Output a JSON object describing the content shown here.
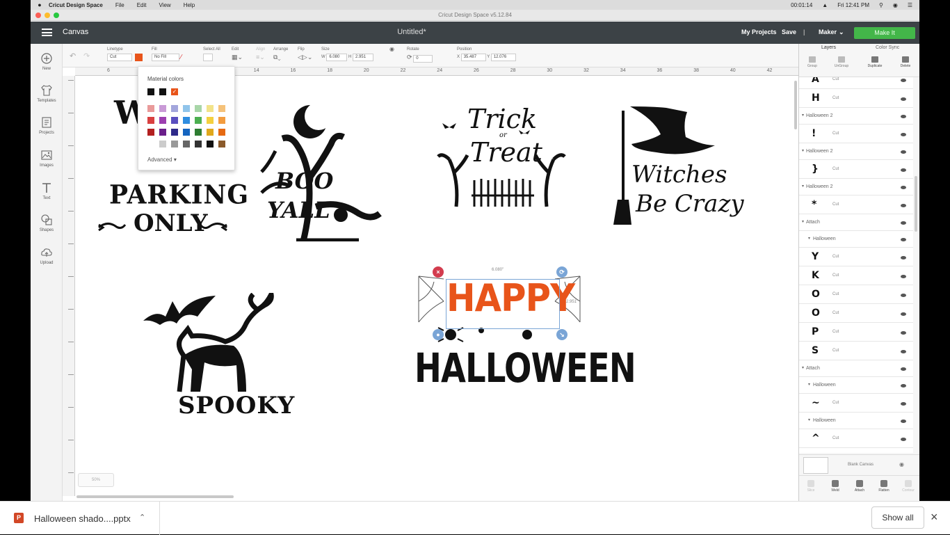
{
  "mac_menu": {
    "app_name": "Cricut Design Space",
    "items": [
      "File",
      "Edit",
      "View",
      "Help"
    ],
    "recording_time": "00:01:14",
    "clock": "Fri 12:41 PM"
  },
  "window": {
    "title": "Cricut Design Space v5.12.84"
  },
  "header": {
    "canvas_label": "Canvas",
    "doc_title": "Untitled*",
    "my_projects": "My Projects",
    "save": "Save",
    "separator": "|",
    "machine": "Maker",
    "make_it": "Make It"
  },
  "left_sidebar": {
    "items": [
      {
        "label": "New",
        "icon": "plus-circle-icon"
      },
      {
        "label": "Templates",
        "icon": "shirt-icon"
      },
      {
        "label": "Projects",
        "icon": "projects-icon"
      },
      {
        "label": "Images",
        "icon": "image-icon"
      },
      {
        "label": "Text",
        "icon": "text-icon"
      },
      {
        "label": "Shapes",
        "icon": "shapes-icon"
      },
      {
        "label": "Upload",
        "icon": "cloud-upload-icon"
      }
    ]
  },
  "toolbar": {
    "linetype_label": "Linetype",
    "linetype_value": "Cut",
    "fill_label": "Fill",
    "fill_value": "No Fill",
    "select_all": "Select All",
    "edit": "Edit",
    "align": "Align",
    "arrange": "Arrange",
    "flip": "Flip",
    "size_label": "Size",
    "size_w_prefix": "W",
    "size_w": "6.080",
    "size_h_prefix": "H",
    "size_h": "2.951",
    "rotate_label": "Rotate",
    "rotate_value": "0",
    "position_label": "Position",
    "position_x_prefix": "X",
    "position_x": "35.487",
    "position_y_prefix": "Y",
    "position_y": "12.076",
    "linetype_color": "#e8541a"
  },
  "ruler_top": [
    "6",
    "8",
    "10",
    "12",
    "14",
    "16",
    "18",
    "20",
    "22",
    "24",
    "26",
    "28",
    "30",
    "32",
    "34",
    "36",
    "38",
    "40",
    "42"
  ],
  "color_popup": {
    "title": "Material colors",
    "advanced": "Advanced",
    "top_row": [
      "#111111",
      "#111111",
      "#e8541a"
    ],
    "grid": [
      [
        "#e99a9a",
        "#c99ad6",
        "#a3a6dc",
        "#90c4ea",
        "#a8d6a8",
        "#f2e38a",
        "#f5c27a"
      ],
      [
        "#d94040",
        "#9c3fb0",
        "#5a4fc0",
        "#2f8de0",
        "#4caf50",
        "#f4d03f",
        "#f39c3f"
      ],
      [
        "#b32020",
        "#6a1f8a",
        "#2e2a8a",
        "#1565c0",
        "#2e7d32",
        "#e0a81d",
        "#e66a12"
      ],
      [
        "#ffffff",
        "#cccccc",
        "#999999",
        "#666666",
        "#333333",
        "#111111",
        "#8b5a2b"
      ]
    ]
  },
  "canvas_art": {
    "witch_parking_top": "W",
    "parking": "PARKING",
    "only": "ONLY",
    "boo": "BOO",
    "yall": "YALL",
    "trick": "Trick",
    "or": "or",
    "treat": "Treat",
    "witches": "Witches",
    "be_crazy": "Be Crazy",
    "spooky": "SPOOKY",
    "happy": "HAPPY",
    "halloween": "HALLOWEEN",
    "happy_color": "#e8541a",
    "sel_width": "6.080\"",
    "sel_height": "2.951\""
  },
  "layers_panel": {
    "tab_layers": "Layers",
    "tab_color_sync": "Color Sync",
    "actions": [
      "Group",
      "UnGroup",
      "Duplicate",
      "Delete"
    ],
    "rows": [
      {
        "type": "item",
        "glyph": "A",
        "text": "Cut"
      },
      {
        "type": "item",
        "glyph": "H",
        "text": "Cut"
      },
      {
        "type": "group",
        "text": "Halloween 2"
      },
      {
        "type": "item",
        "glyph": "!",
        "text": "Cut"
      },
      {
        "type": "group",
        "text": "Halloween 2"
      },
      {
        "type": "item",
        "glyph": "}",
        "text": "Cut"
      },
      {
        "type": "group",
        "text": "Halloween 2"
      },
      {
        "type": "item",
        "glyph": "*",
        "text": "Cut"
      },
      {
        "type": "group",
        "text": "Attach"
      },
      {
        "type": "subgroup",
        "text": "Halloween"
      },
      {
        "type": "item",
        "glyph": "Y",
        "text": "Cut"
      },
      {
        "type": "item",
        "glyph": "K",
        "text": "Cut"
      },
      {
        "type": "item",
        "glyph": "O",
        "text": "Cut"
      },
      {
        "type": "item",
        "glyph": "O",
        "text": "Cut"
      },
      {
        "type": "item",
        "glyph": "P",
        "text": "Cut"
      },
      {
        "type": "item",
        "glyph": "S",
        "text": "Cut"
      },
      {
        "type": "group",
        "text": "Attach"
      },
      {
        "type": "subgroup",
        "text": "Halloween"
      },
      {
        "type": "item",
        "glyph": "~",
        "text": "Cut"
      },
      {
        "type": "subgroup",
        "text": "Halloween"
      },
      {
        "type": "item",
        "glyph": "^",
        "text": "Cut"
      }
    ],
    "blank_canvas": "Blank Canvas",
    "bottom_actions": [
      "Slice",
      "Weld",
      "Attach",
      "Flatten",
      "Contour"
    ]
  },
  "zoom": "50%",
  "download_shelf": {
    "file_name": "Halloween shado....pptx",
    "file_icon_letter": "P",
    "show_all": "Show all"
  }
}
